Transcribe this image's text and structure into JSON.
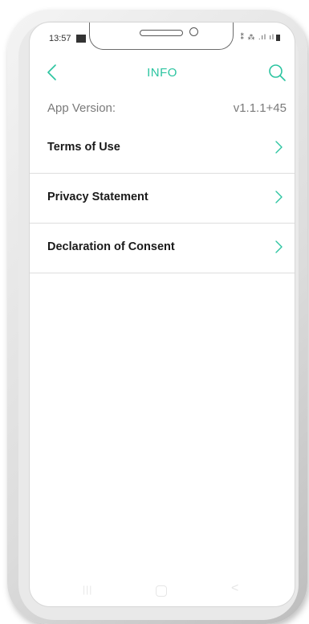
{
  "status_bar": {
    "time": "13:57",
    "icons": "⁑ ⁂ .ıl ıl"
  },
  "header": {
    "title": "INFO",
    "back_icon": "chevron-left-icon",
    "search_icon": "search-icon"
  },
  "info": {
    "version_label": "App Version:",
    "version_value": "v1.1.1+45"
  },
  "menu": {
    "items": [
      {
        "label": "Terms of Use"
      },
      {
        "label": "Privacy Statement"
      },
      {
        "label": "Declaration of Consent"
      }
    ]
  },
  "navbar": {
    "recent": "|||",
    "back": "<"
  },
  "colors": {
    "accent": "#2bc4a0",
    "text": "#1a1a1a",
    "muted": "#7a7a7a",
    "divider": "#dedede"
  }
}
